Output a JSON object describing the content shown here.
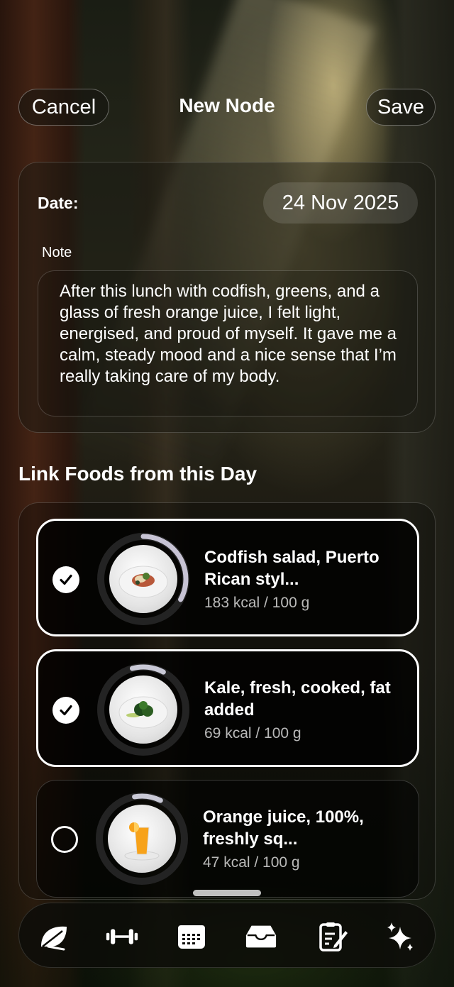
{
  "header": {
    "cancel_label": "Cancel",
    "title": "New Node",
    "save_label": "Save"
  },
  "note_card": {
    "date_label": "Date:",
    "date_value": "24 Nov 2025",
    "note_label": "Note",
    "note_text": "After this lunch with codfish, greens, and a glass of fresh orange juice, I felt light, energised, and proud of myself. It gave me a calm, steady mood and a nice sense that I’m really taking care of my body."
  },
  "link_foods": {
    "title": "Link Foods from this Day",
    "items": [
      {
        "name": "Codfish salad, Puerto Rican styl...",
        "kcal": "183 kcal / 100 g",
        "selected": true,
        "ring_progress": 0.33,
        "icon": "codfish-salad-plate"
      },
      {
        "name": "Kale, fresh, cooked, fat added",
        "kcal": "69 kcal / 100 g",
        "selected": true,
        "ring_progress": 0.12,
        "icon": "kale-plate"
      },
      {
        "name": "Orange juice, 100%,  freshly sq...",
        "kcal": "47 kcal / 100 g",
        "selected": false,
        "ring_progress": 0.1,
        "icon": "orange-juice-glass"
      }
    ]
  },
  "tabbar": {
    "tabs": [
      "leaf-icon",
      "dumbbell-icon",
      "calendar-icon",
      "tray-icon",
      "notes-pencil-icon",
      "sparkles-icon"
    ]
  },
  "colors": {
    "ring_track": "#2a2a2a",
    "ring_progress": "#c9c9d6",
    "accent": "#ffffff"
  }
}
